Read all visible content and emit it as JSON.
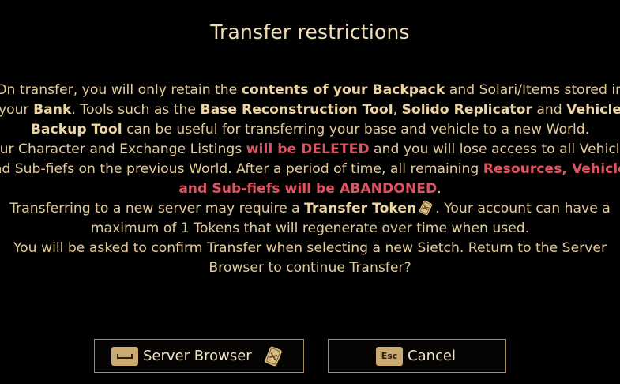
{
  "dialog": {
    "title": "Transfer restrictions",
    "paragraphs": {
      "p1_a": "On transfer, you will only retain the ",
      "p1_b": "contents of your Backpack",
      "p1_c": " and Solari/Items stored in your ",
      "p1_d": "Bank",
      "p1_e": ". Tools such as the ",
      "p1_f": "Base Reconstruction Tool",
      "p1_g": ", ",
      "p1_h": "Solido Replicator",
      "p1_i": " and ",
      "p1_j": "Vehicle Backup Tool",
      "p1_k": " can be useful for transferring your base and vehicle to a new World.",
      "p2_a": "Your Character and Exchange Listings ",
      "p2_b": "will be DELETED",
      "p2_c": " and you will lose access to all Vehicles and Sub-fiefs on the previous World. After a period of time, all remaining ",
      "p2_d": "Resources, Vehicles and Sub-fiefs will be ABANDONED",
      "p2_e": ".",
      "p3_a": "Transferring to a new server may require a ",
      "p3_b": "Transfer Token",
      "p3_c": ". Your account can have a maximum of 1 Tokens that will regenerate over time when used.",
      "p4": "You will be asked to confirm Transfer when selecting a new Sietch. Return to the Server Browser to continue Transfer?"
    }
  },
  "buttons": {
    "server_browser": {
      "label": "Server Browser",
      "key_icon": "spacebar-key-icon",
      "extra_icon": "transfer-token-icon"
    },
    "cancel": {
      "label": "Cancel",
      "key": "Esc"
    }
  },
  "colors": {
    "background": "#000000",
    "text": "#e3cb99",
    "title": "#f2dfb6",
    "warning": "#e0525f",
    "button_border": "#a7895a",
    "keycap": "#c9ab72"
  }
}
